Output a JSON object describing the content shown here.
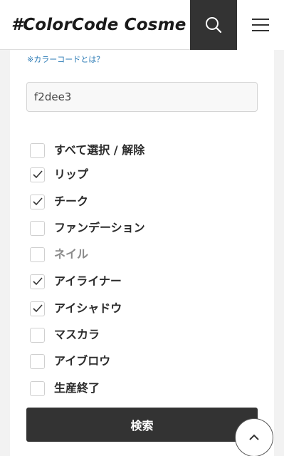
{
  "header": {
    "logo": "#ColorCode Cosme",
    "search_icon": "search-icon",
    "menu_icon": "hamburger-menu-icon"
  },
  "form": {
    "help_link": "※カラーコードとは？",
    "color_code_value": "f2dee3",
    "options": [
      {
        "label": "すべて選択 / 解除",
        "checked": false
      },
      {
        "label": "リップ",
        "checked": true
      },
      {
        "label": "チーク",
        "checked": true
      },
      {
        "label": "ファンデーション",
        "checked": false
      },
      {
        "label": "ネイル",
        "checked": false
      },
      {
        "label": "アイライナー",
        "checked": true
      },
      {
        "label": "アイシャドウ",
        "checked": true
      },
      {
        "label": "マスカラ",
        "checked": false
      },
      {
        "label": "アイブロウ",
        "checked": false
      },
      {
        "label": "生産終了",
        "checked": false
      }
    ],
    "submit_label": "検索"
  },
  "back_to_top_icon": "chevron-up-icon"
}
